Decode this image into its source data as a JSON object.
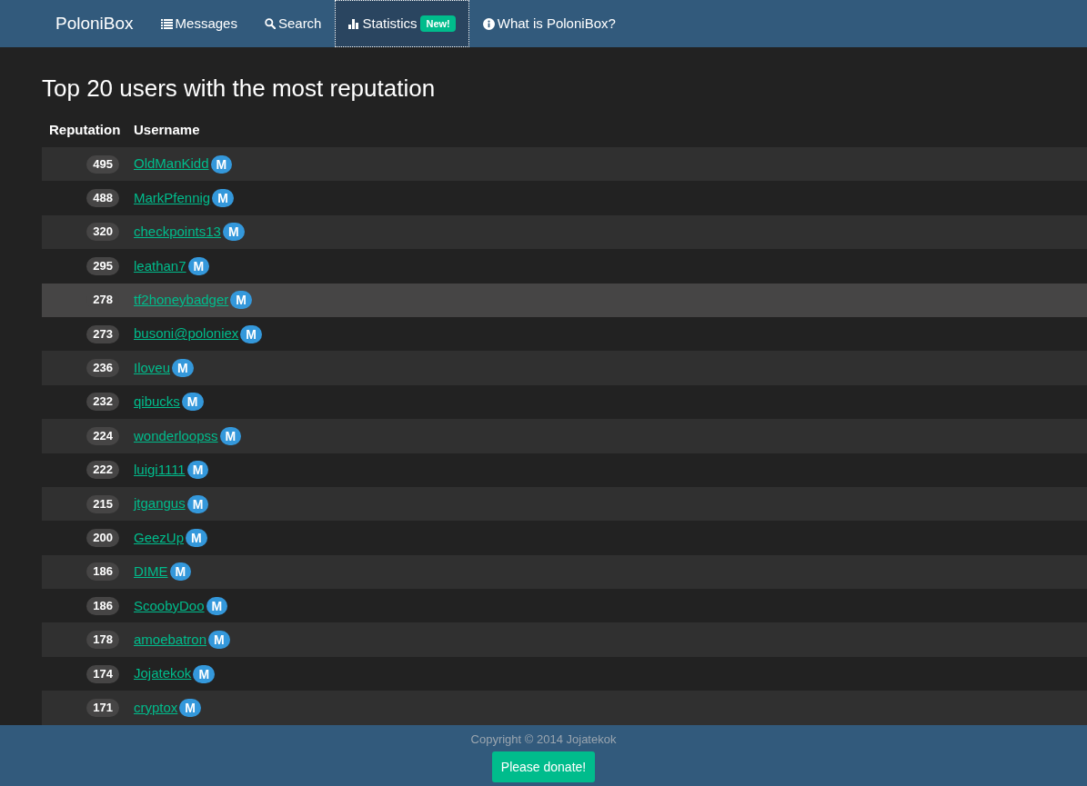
{
  "navbar": {
    "brand": "PoloniBox",
    "items": [
      {
        "label": "Messages",
        "selected": false
      },
      {
        "label": "Search",
        "selected": false
      },
      {
        "label": "Statistics",
        "selected": true,
        "badge": "New!"
      },
      {
        "label": "What is PoloniBox?",
        "selected": false
      }
    ]
  },
  "heading": "Top 20 users with the most reputation",
  "table": {
    "columns": [
      "Reputation",
      "Username"
    ],
    "rows": [
      {
        "reputation": "495",
        "username": "OldManKidd",
        "badge": "M",
        "highlighted": false
      },
      {
        "reputation": "488",
        "username": "MarkPfennig",
        "badge": "M",
        "highlighted": false
      },
      {
        "reputation": "320",
        "username": "checkpoints13",
        "badge": "M",
        "highlighted": false
      },
      {
        "reputation": "295",
        "username": "leathan7",
        "badge": "M",
        "highlighted": false
      },
      {
        "reputation": "278",
        "username": "tf2honeybadger",
        "badge": "M",
        "highlighted": true
      },
      {
        "reputation": "273",
        "username": "busoni@poloniex",
        "badge": "M",
        "highlighted": false
      },
      {
        "reputation": "236",
        "username": "Iloveu",
        "badge": "M",
        "highlighted": false
      },
      {
        "reputation": "232",
        "username": "qibucks",
        "badge": "M",
        "highlighted": false
      },
      {
        "reputation": "224",
        "username": "wonderloopss",
        "badge": "M",
        "highlighted": false
      },
      {
        "reputation": "222",
        "username": "luigi1111",
        "badge": "M",
        "highlighted": false
      },
      {
        "reputation": "215",
        "username": "jtgangus",
        "badge": "M",
        "highlighted": false
      },
      {
        "reputation": "200",
        "username": "GeezUp",
        "badge": "M",
        "highlighted": false
      },
      {
        "reputation": "186",
        "username": "DIME",
        "badge": "M",
        "highlighted": false
      },
      {
        "reputation": "186",
        "username": "ScoobyDoo",
        "badge": "M",
        "highlighted": false
      },
      {
        "reputation": "178",
        "username": "amoebatron",
        "badge": "M",
        "highlighted": false
      },
      {
        "reputation": "174",
        "username": "Jojatekok",
        "badge": "M",
        "highlighted": false
      },
      {
        "reputation": "171",
        "username": "cryptox",
        "badge": "M",
        "highlighted": false
      }
    ]
  },
  "footer": {
    "copyright": "Copyright © 2014 Jojatekok",
    "button": "Please donate!"
  }
}
